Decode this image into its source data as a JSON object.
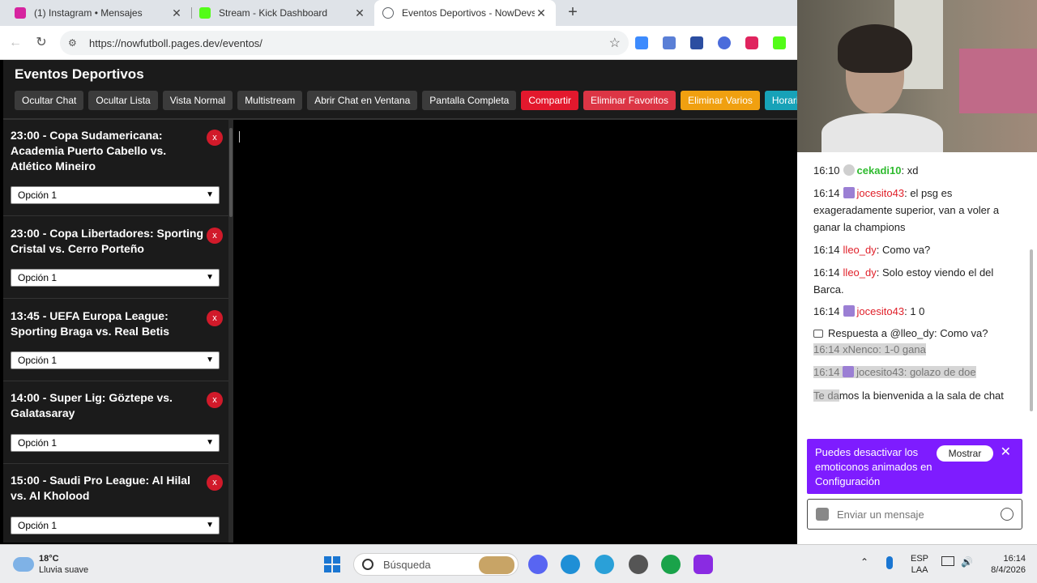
{
  "browser": {
    "tabs": [
      {
        "title": "(1) Instagram • Mensajes",
        "favicon_color": "#d6249f"
      },
      {
        "title": "Stream - Kick Dashboard",
        "favicon_color": "#53fc18"
      },
      {
        "title": "Eventos Deportivos - NowDevs",
        "favicon_color": "#5f6368"
      }
    ],
    "new_tab": "+",
    "url": "https://nowfutboll.pages.dev/eventos/"
  },
  "page": {
    "title": "Eventos Deportivos",
    "buttons": [
      {
        "label": "Ocultar Chat",
        "style": "dark"
      },
      {
        "label": "Ocultar Lista",
        "style": "dark"
      },
      {
        "label": "Vista Normal",
        "style": "dark"
      },
      {
        "label": "Multistream",
        "style": "dark"
      },
      {
        "label": "Abrir Chat en Ventana",
        "style": "dark"
      },
      {
        "label": "Pantalla Completa",
        "style": "dark"
      },
      {
        "label": "Compartir",
        "style": "red"
      },
      {
        "label": "Eliminar Favoritos",
        "style": "pink"
      },
      {
        "label": "Eliminar Varios",
        "style": "orange"
      },
      {
        "label": "Horario",
        "style": "teal"
      }
    ],
    "events": [
      {
        "title": "23:00 - Copa Sudamericana: Academia Puerto Cabello vs. Atlético Mineiro",
        "option": "Opción 1",
        "delete": "x"
      },
      {
        "title": "23:00 - Copa Libertadores: Sporting Cristal vs. Cerro Porteño",
        "option": "Opción 1",
        "delete": "x"
      },
      {
        "title": "13:45 - UEFA Europa League: Sporting Braga vs. Real Betis",
        "option": "Opción 1",
        "delete": "x"
      },
      {
        "title": "14:00 - Super Lig: Göztepe vs. Galatasaray",
        "option": "Opción 1",
        "delete": "x"
      },
      {
        "title": "15:00 - Saudi Pro League: Al Hilal vs. Al Kholood",
        "option": "Opción 1",
        "delete": "x"
      }
    ]
  },
  "chat": {
    "messages": [
      {
        "time": "16:10",
        "user": "cekadi10",
        "text": ": xd",
        "style": "green"
      },
      {
        "time": "16:14",
        "user": "jocesito43",
        "text": ": el psg es exageradamente superior, van a voler a ganar la champions",
        "style": "red"
      },
      {
        "time": "16:14",
        "user": "lleo_dy",
        "text": ": Como va?",
        "style": "red"
      },
      {
        "time": "16:14",
        "user": "lleo_dy",
        "text": ": Solo estoy viendo el del Barca.",
        "style": "red"
      },
      {
        "time": "16:14",
        "user": "jocesito43",
        "text": ": 1 0",
        "style": "red"
      }
    ],
    "reply": "Respuesta a @lleo_dy: Como va?",
    "faded": [
      {
        "time": "16:14",
        "user": "xNenco",
        "text": ": 1-0 gana"
      },
      {
        "time": "16:14",
        "user": "jocesito43",
        "text": ": golazo de doe"
      }
    ],
    "welcome_prefix": "Te da",
    "welcome": "mos la bienvenida a la sala de chat",
    "notice": {
      "text": "Puedes desactivar los emoticonos animados en Configuración",
      "button": "Mostrar",
      "close": "✕"
    },
    "input_placeholder": "Enviar un mensaje"
  },
  "taskbar": {
    "weather_temp": "18°C",
    "weather_desc": "Lluvia suave",
    "search": "Búsqueda",
    "lang_line1": "ESP",
    "lang_line2": "LAA",
    "time": "16:14",
    "date": "8/4/2026"
  }
}
